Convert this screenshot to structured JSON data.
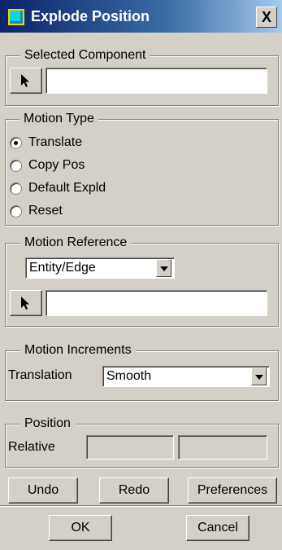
{
  "window": {
    "title": "Explode Position",
    "close_label": "X"
  },
  "selected_component": {
    "legend": "Selected Component",
    "value": ""
  },
  "motion_type": {
    "legend": "Motion Type",
    "options": [
      "Translate",
      "Copy Pos",
      "Default Expld",
      "Reset"
    ],
    "selected": "Translate"
  },
  "motion_reference": {
    "legend": "Motion Reference",
    "dropdown_value": "Entity/Edge",
    "value": ""
  },
  "motion_increments": {
    "legend": "Motion Increments",
    "translation_label": "Translation",
    "translation_value": "Smooth"
  },
  "position": {
    "legend": "Position",
    "relative_label": "Relative",
    "field1": "",
    "field2": ""
  },
  "buttons": {
    "undo": "Undo",
    "redo": "Redo",
    "preferences": "Preferences",
    "ok": "OK",
    "cancel": "Cancel"
  },
  "icons": {
    "title_icon": "window-app-icon",
    "select_cursor": "arrow-cursor-icon"
  }
}
